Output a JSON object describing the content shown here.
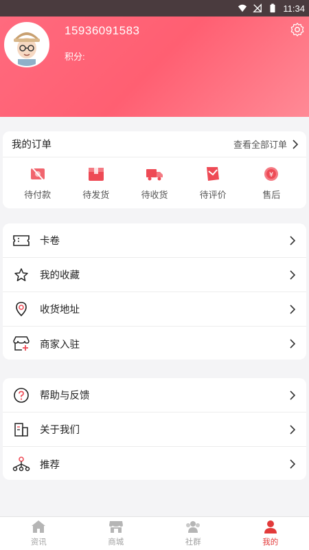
{
  "status_bar": {
    "time": "11:34"
  },
  "profile": {
    "phone": "15936091583",
    "points_label": "积分:"
  },
  "orders": {
    "title": "我的订单",
    "view_all": "查看全部订单",
    "items": [
      {
        "label": "待付款",
        "icon": "unpaid-icon"
      },
      {
        "label": "待发货",
        "icon": "to-ship-icon"
      },
      {
        "label": "待收货",
        "icon": "to-receive-truck-icon"
      },
      {
        "label": "待评价",
        "icon": "to-review-icon"
      },
      {
        "label": "售后",
        "icon": "after-sales-icon"
      }
    ]
  },
  "menu_group1": [
    {
      "label": "卡卷",
      "icon": "coupon-icon"
    },
    {
      "label": "我的收藏",
      "icon": "star-icon"
    },
    {
      "label": "收货地址",
      "icon": "location-icon"
    },
    {
      "label": "商家入驻",
      "icon": "store-icon"
    }
  ],
  "menu_group2": [
    {
      "label": "帮助与反馈",
      "icon": "help-icon"
    },
    {
      "label": "关于我们",
      "icon": "building-icon"
    },
    {
      "label": "推荐",
      "icon": "share-network-icon"
    }
  ],
  "bottom_nav": [
    {
      "label": "资讯",
      "icon": "home-icon"
    },
    {
      "label": "商城",
      "icon": "shop-icon"
    },
    {
      "label": "社群",
      "icon": "community-icon"
    },
    {
      "label": "我的",
      "icon": "user-icon",
      "active": true
    }
  ],
  "colors": {
    "accent": "#ff5f72",
    "active_nav": "#e23a3a",
    "icon_red": "#ee4a55"
  }
}
